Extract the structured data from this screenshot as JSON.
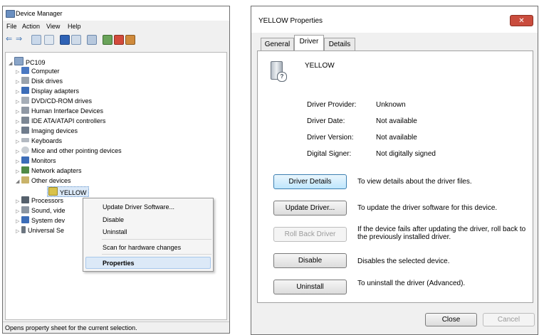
{
  "device_manager": {
    "title": "Device Manager",
    "menu": [
      "File",
      "Action",
      "View",
      "Help"
    ],
    "tree": {
      "root": "PC109",
      "categories": [
        {
          "label": "Computer"
        },
        {
          "label": "Disk drives"
        },
        {
          "label": "Display adapters"
        },
        {
          "label": "DVD/CD-ROM drives"
        },
        {
          "label": "Human Interface Devices"
        },
        {
          "label": "IDE ATA/ATAPI controllers"
        },
        {
          "label": "Imaging devices"
        },
        {
          "label": "Keyboards"
        },
        {
          "label": "Mice and other pointing devices"
        },
        {
          "label": "Monitors"
        },
        {
          "label": "Network adapters"
        },
        {
          "label": "Other devices"
        },
        {
          "label": "YELLOW"
        },
        {
          "label": "Processors"
        },
        {
          "label": "Sound, vide"
        },
        {
          "label": "System dev"
        },
        {
          "label": "Universal Se"
        }
      ]
    },
    "status": "Opens property sheet for the current selection."
  },
  "context_menu": {
    "items": [
      "Update Driver Software...",
      "Disable",
      "Uninstall",
      "Scan for hardware changes",
      "Properties"
    ]
  },
  "properties": {
    "title": "YELLOW Properties",
    "close_glyph": "✕",
    "tabs": [
      "General",
      "Driver",
      "Details"
    ],
    "device_name": "YELLOW",
    "info": {
      "provider_label": "Driver Provider:",
      "provider_value": "Unknown",
      "date_label": "Driver Date:",
      "date_value": "Not available",
      "version_label": "Driver Version:",
      "version_value": "Not available",
      "signer_label": "Digital Signer:",
      "signer_value": "Not digitally signed"
    },
    "buttons": {
      "details": "Driver Details",
      "details_desc": "To view details about the driver files.",
      "update": "Update Driver...",
      "update_desc": "To update the driver software for this device.",
      "rollback": "Roll Back Driver",
      "rollback_desc": "If the device fails after updating the driver, roll back to the previously installed driver.",
      "disable": "Disable",
      "disable_desc": "Disables the selected device.",
      "uninstall": "Uninstall",
      "uninstall_desc": "To uninstall the driver (Advanced)."
    },
    "footer": {
      "close": "Close",
      "cancel": "Cancel"
    }
  }
}
